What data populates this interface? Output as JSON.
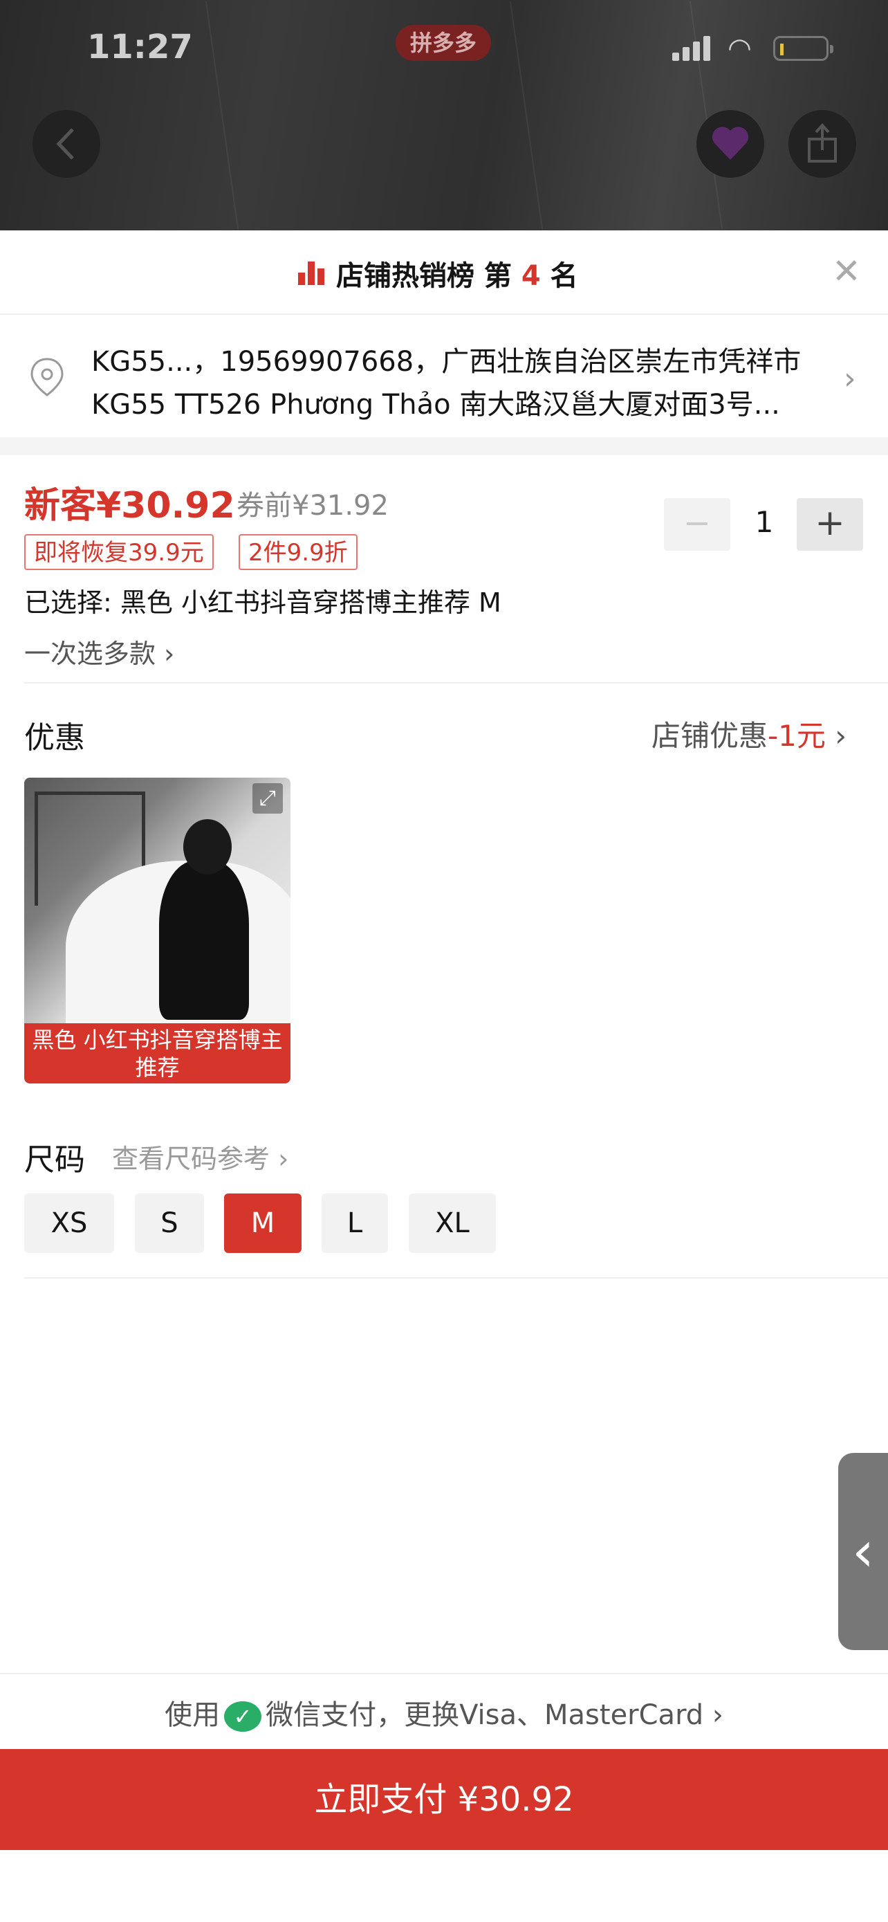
{
  "status_bar": {
    "time": "11:27",
    "app_badge": "拼多多"
  },
  "rank": {
    "prefix": "店铺热销榜 第 ",
    "number": "4",
    "suffix": " 名"
  },
  "address": {
    "line1": "KG55...，19569907668，广西壮族自治区崇左市凭祥市",
    "line2": "KG55 TT526 Phương Thảo 南大路汉邕大厦对面3号..."
  },
  "price": {
    "new": "新客¥30.92",
    "before_coupon": "券前¥31.92",
    "tags": [
      "即将恢复39.9元",
      "2件9.9折"
    ],
    "quantity": "1"
  },
  "selection": {
    "selected": "已选择: 黑色 小红书抖音穿搭博主推荐 M",
    "multi": "一次选多款"
  },
  "promo": {
    "title": "优惠",
    "label": "店铺优惠",
    "value": "-1元"
  },
  "sku": {
    "label": "黑色 小红书抖音穿搭博主推荐"
  },
  "size": {
    "title": "尺码",
    "reference": "查看尺码参考",
    "options": [
      "XS",
      "S",
      "M",
      "L",
      "XL"
    ],
    "selected": "M"
  },
  "payment": {
    "prefix": "使用",
    "method": "微信支付，更换Visa、MasterCard"
  },
  "pay_button": {
    "label": "立即支付 ¥30.92"
  },
  "colors": {
    "accent": "#d6352c",
    "wechat": "#2aae67"
  }
}
